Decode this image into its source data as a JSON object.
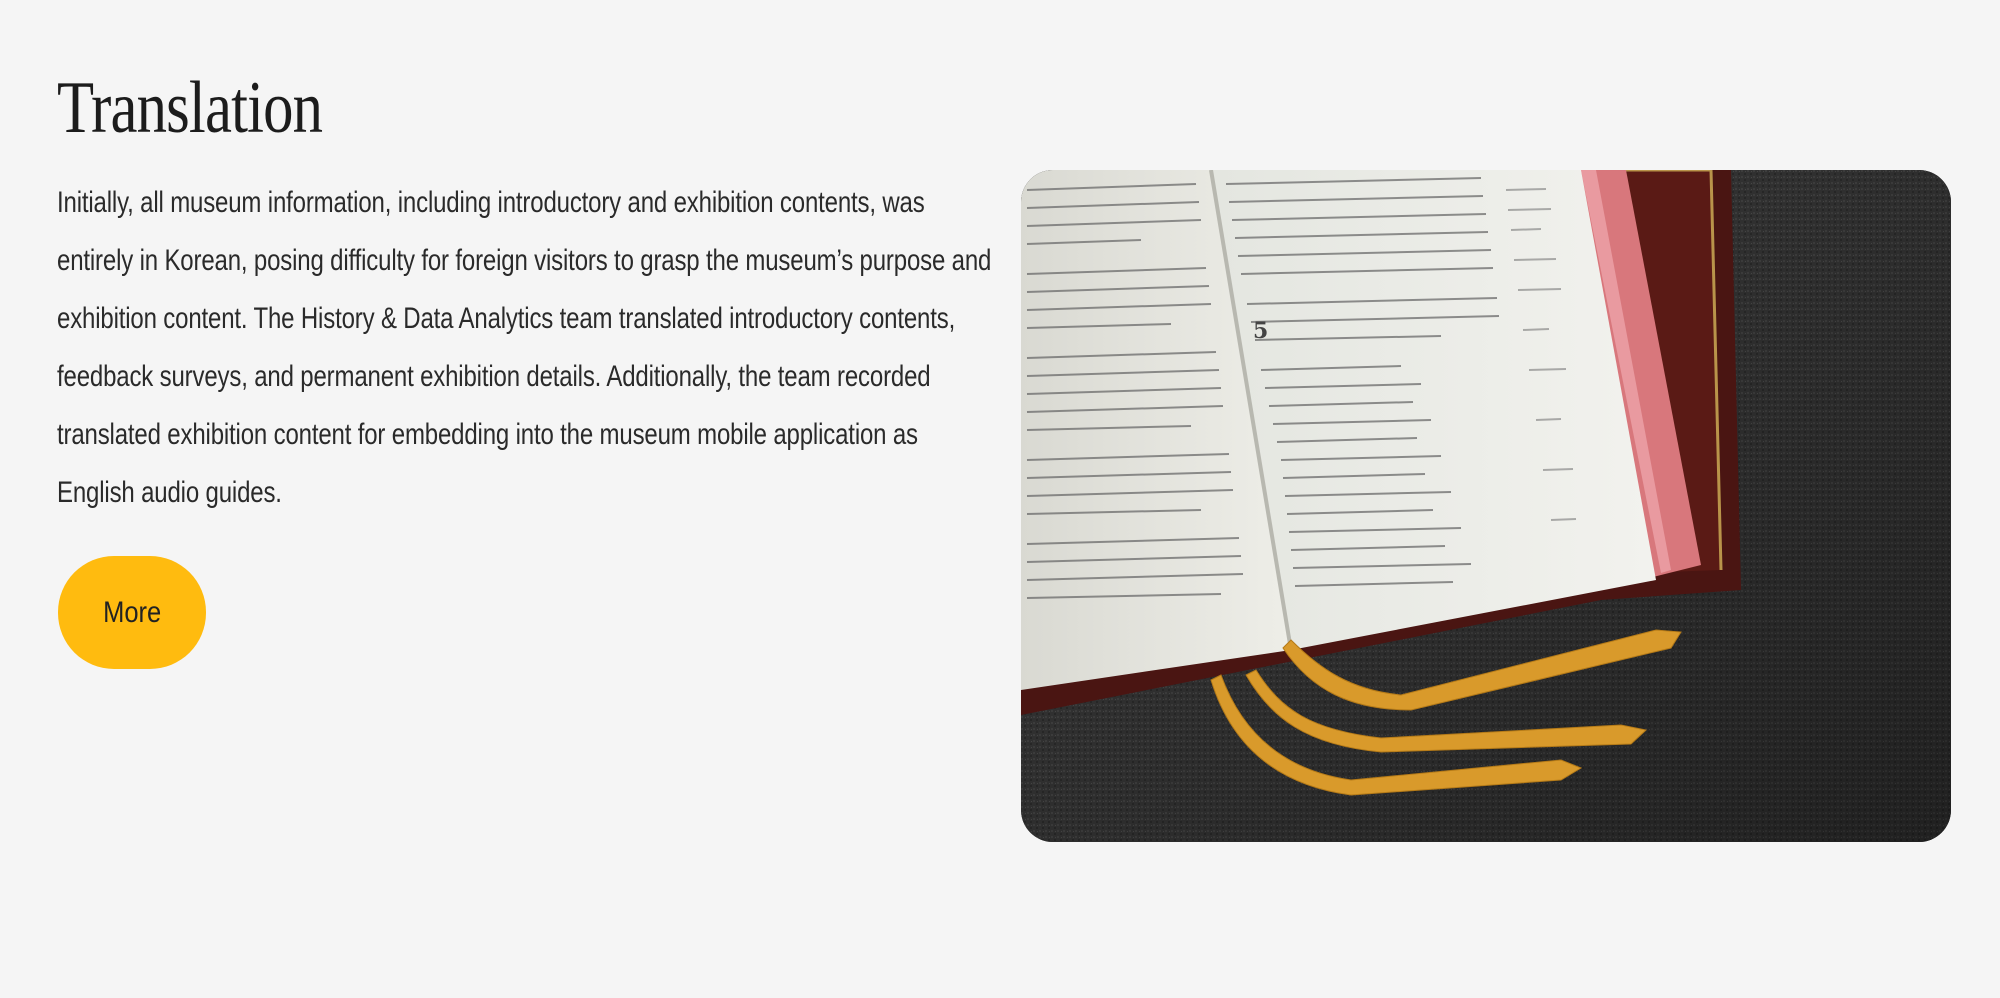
{
  "section": {
    "title": "Translation",
    "body": "Initially, all museum information, including introductory and exhibition contents, was entirely in Korean, posing difficulty for foreign visitors to grasp the museum’s purpose and exhibition content. The History & Data Analytics team translated introductory contents, feedback surveys, and permanent exhibition details. Additionally, the team recorded translated exhibition content for embedding into the museum mobile application as English audio guides.",
    "button_label": "More"
  },
  "image": {
    "subject": "open-book-with-ribbon-bookmarks",
    "page_number": "5"
  },
  "colors": {
    "background": "#f5f5f5",
    "button": "#ffbb0f",
    "text": "#2a2a2a"
  }
}
